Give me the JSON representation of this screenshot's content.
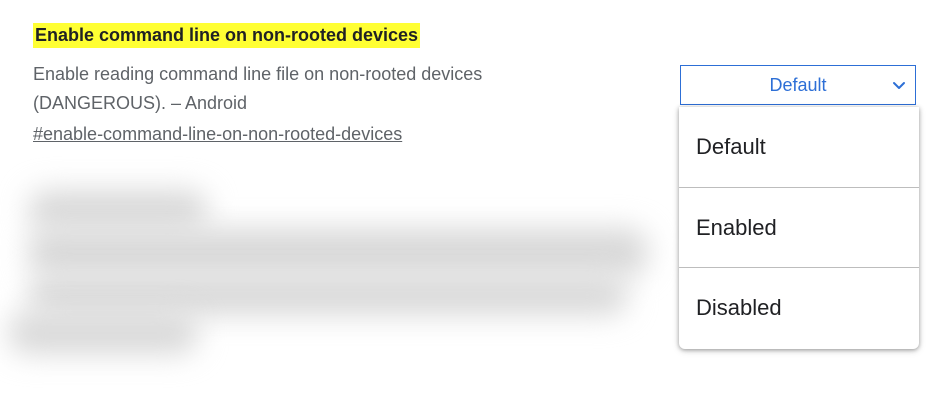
{
  "flag": {
    "title": "Enable command line on non-rooted devices",
    "description": "Enable reading command line file on non-rooted devices (DANGEROUS). – Android",
    "anchor": "#enable-command-line-on-non-rooted-devices"
  },
  "select": {
    "value": "Default",
    "options": [
      "Default",
      "Enabled",
      "Disabled"
    ]
  },
  "colors": {
    "highlight": "#ffff33",
    "accent": "#2d6fd6",
    "text": "#202124",
    "muted": "#5f6368"
  },
  "icons": {
    "dropdown_indicator": "chevron-down-icon"
  }
}
